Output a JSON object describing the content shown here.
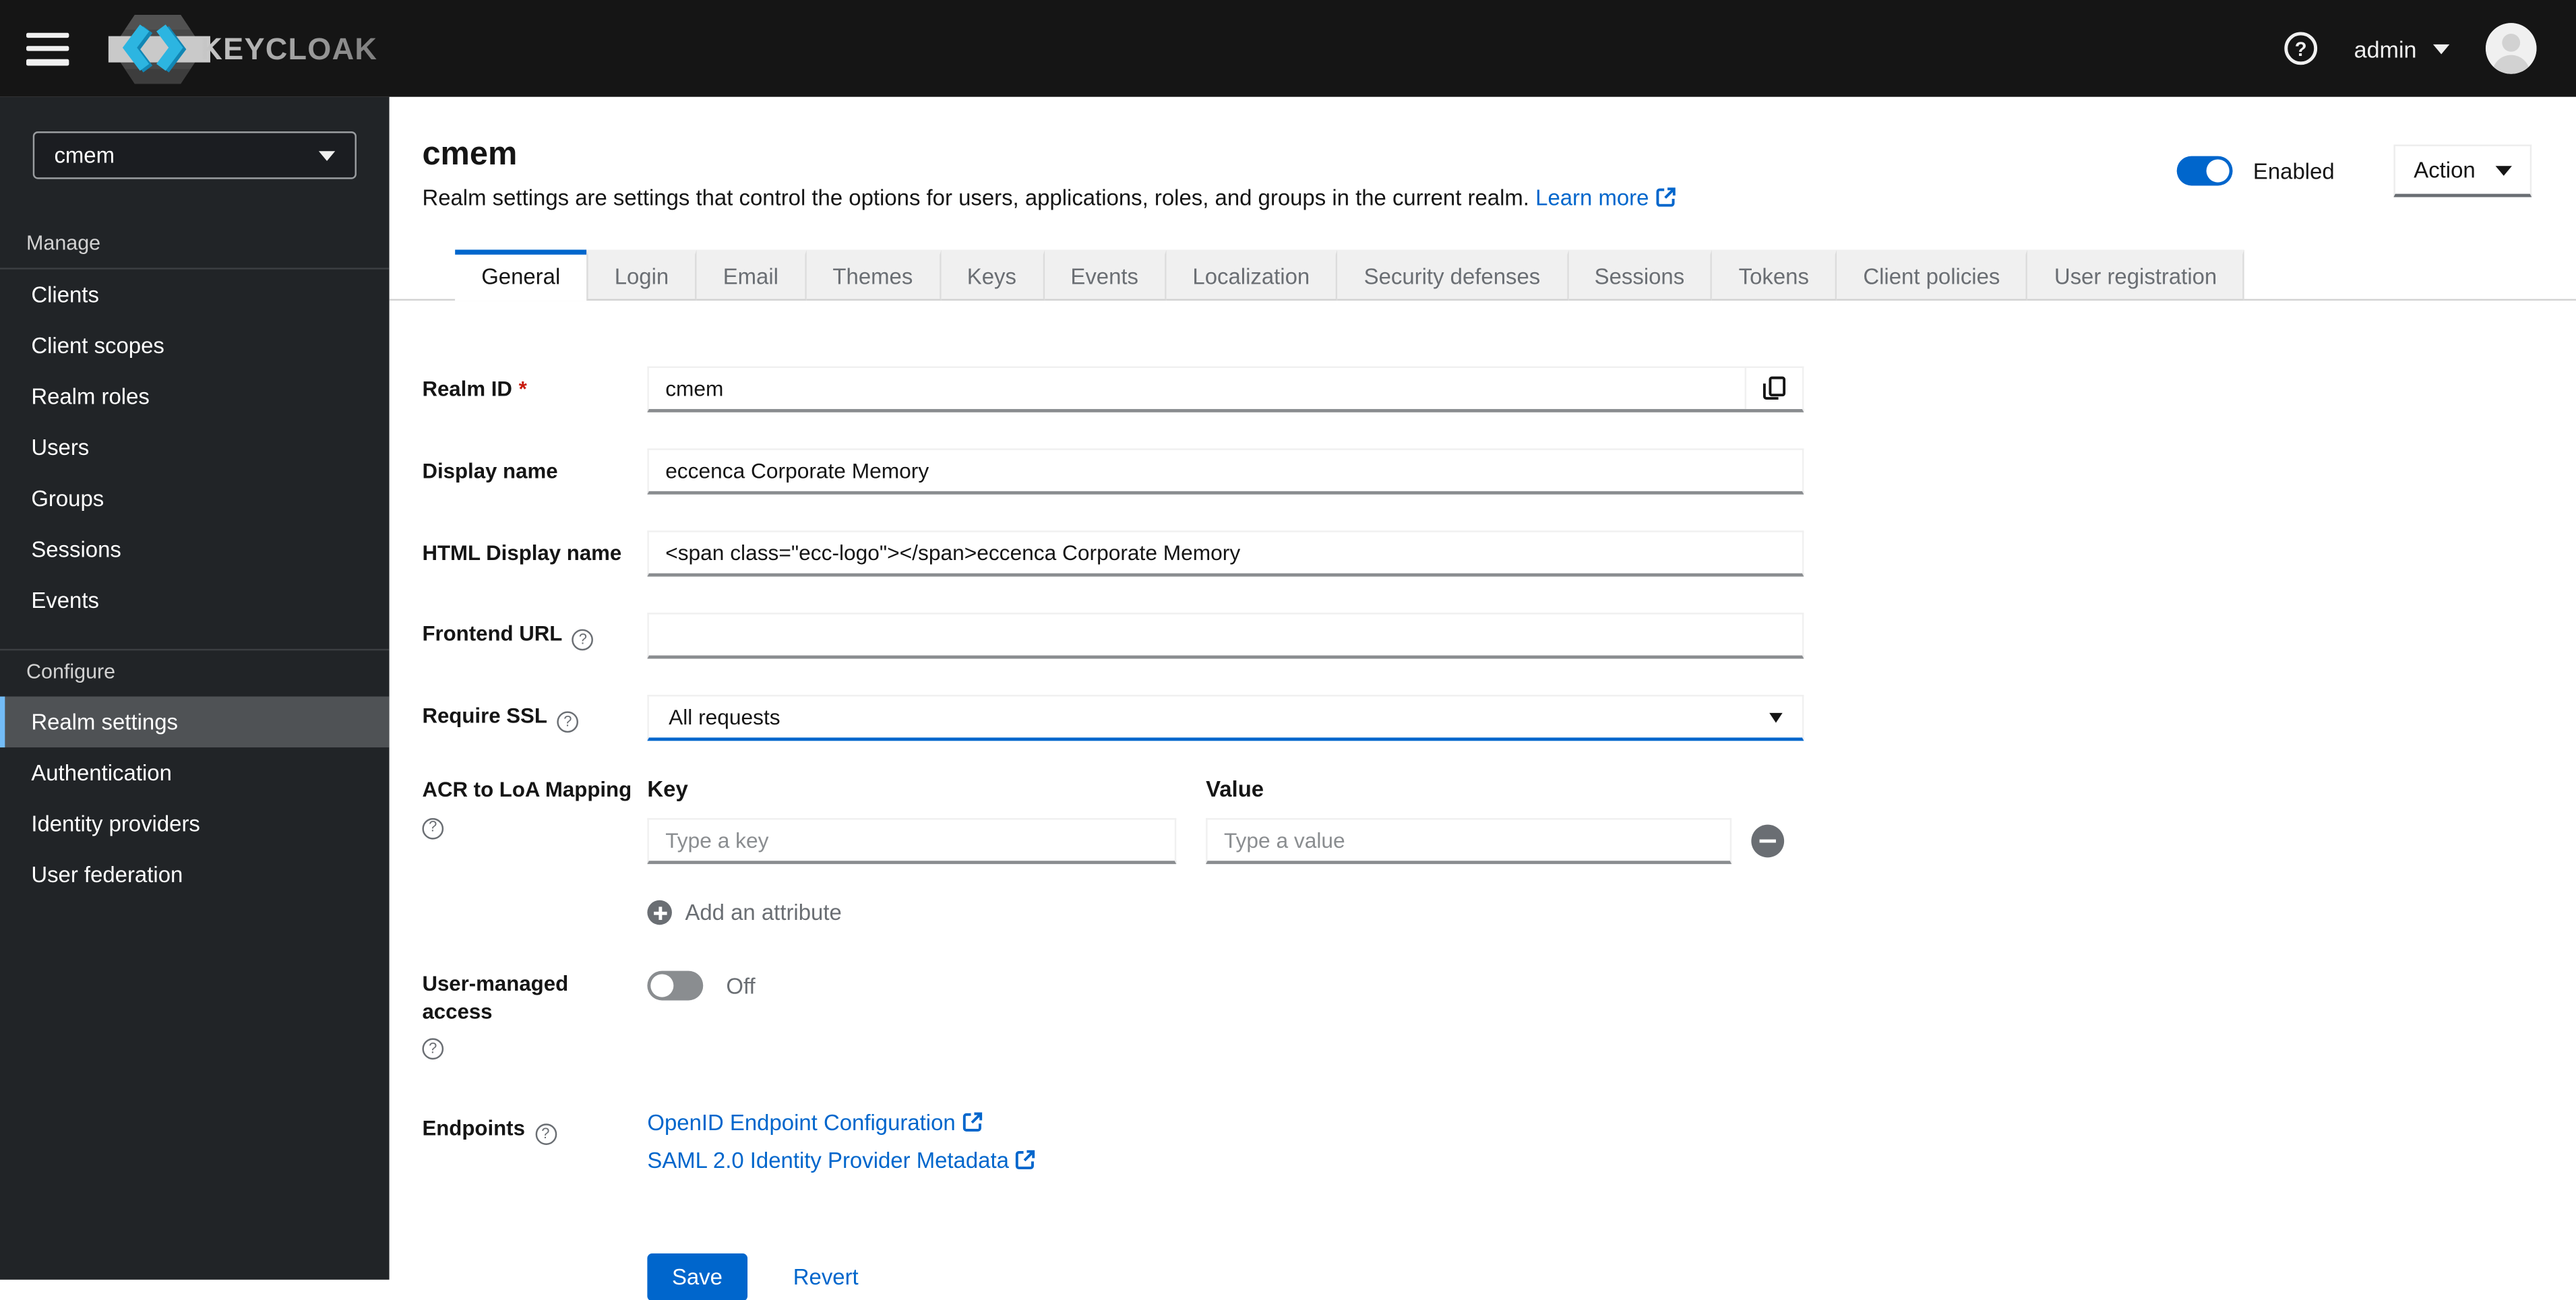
{
  "header": {
    "brand": "KEYCLOAK",
    "username": "admin"
  },
  "sidebar": {
    "realm_selector": {
      "value": "cmem"
    },
    "manage": {
      "title": "Manage",
      "items": [
        {
          "label": "Clients"
        },
        {
          "label": "Client scopes"
        },
        {
          "label": "Realm roles"
        },
        {
          "label": "Users"
        },
        {
          "label": "Groups"
        },
        {
          "label": "Sessions"
        },
        {
          "label": "Events"
        }
      ]
    },
    "configure": {
      "title": "Configure",
      "items": [
        {
          "label": "Realm settings"
        },
        {
          "label": "Authentication"
        },
        {
          "label": "Identity providers"
        },
        {
          "label": "User federation"
        }
      ]
    }
  },
  "page": {
    "title": "cmem",
    "description": "Realm settings are settings that control the options for users, applications, roles, and groups in the current realm.",
    "learn_more": "Learn more",
    "enabled_label": "Enabled",
    "action_label": "Action"
  },
  "tabs": {
    "items": [
      {
        "label": "General"
      },
      {
        "label": "Login"
      },
      {
        "label": "Email"
      },
      {
        "label": "Themes"
      },
      {
        "label": "Keys"
      },
      {
        "label": "Events"
      },
      {
        "label": "Localization"
      },
      {
        "label": "Security defenses"
      },
      {
        "label": "Sessions"
      },
      {
        "label": "Tokens"
      },
      {
        "label": "Client policies"
      },
      {
        "label": "User registration"
      }
    ]
  },
  "form": {
    "realm_id": {
      "label": "Realm ID",
      "required": "*",
      "value": "cmem"
    },
    "display_name": {
      "label": "Display name",
      "value": "eccenca Corporate Memory"
    },
    "html_display_name": {
      "label": "HTML Display name",
      "value": "<span class=\"ecc-logo\"></span>eccenca Corporate Memory"
    },
    "frontend_url": {
      "label": "Frontend URL",
      "value": ""
    },
    "require_ssl": {
      "label": "Require SSL",
      "value": "All requests"
    },
    "acr_loa": {
      "label": "ACR to LoA Mapping",
      "key_header": "Key",
      "value_header": "Value",
      "key_placeholder": "Type a key",
      "value_placeholder": "Type a value",
      "add_label": "Add an attribute"
    },
    "uma": {
      "label": "User-managed access",
      "state": "Off"
    },
    "endpoints": {
      "label": "Endpoints",
      "links": [
        {
          "label": "OpenID Endpoint Configuration"
        },
        {
          "label": "SAML 2.0 Identity Provider Metadata"
        }
      ]
    },
    "actions": {
      "save": "Save",
      "revert": "Revert"
    }
  },
  "colors": {
    "accent": "#0066cc",
    "header_bg": "#151515",
    "sidebar_bg": "#212427",
    "selected_nav_bg": "#4f5255",
    "selected_nav_border": "#73bcf7",
    "required_red": "#c9190b",
    "logo_cyan": "#29b0d5"
  }
}
